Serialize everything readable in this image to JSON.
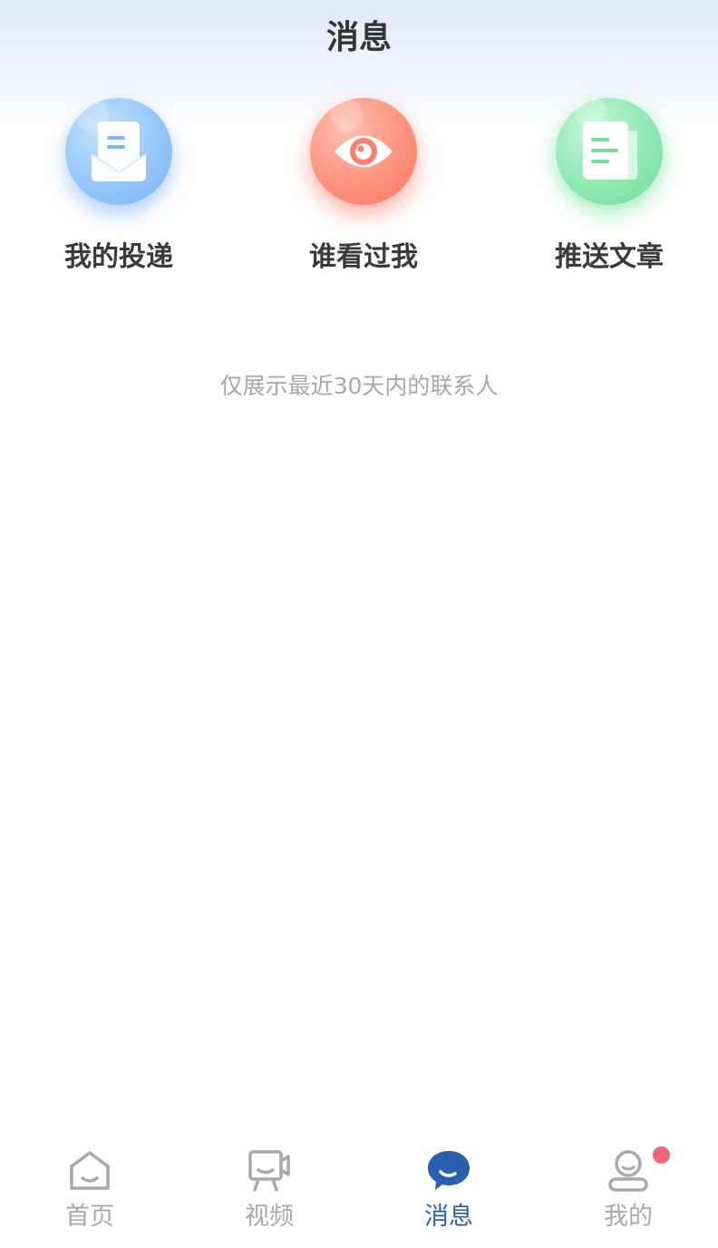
{
  "header": {
    "title": "消息"
  },
  "shortcuts": [
    {
      "label": "我的投递",
      "icon": "envelope-document-icon",
      "color": "#8fc2fa"
    },
    {
      "label": "谁看过我",
      "icon": "eye-icon",
      "color": "#fb8a74"
    },
    {
      "label": "推送文章",
      "icon": "article-icon",
      "color": "#86e6a8"
    }
  ],
  "main": {
    "notice": "仅展示最近30天内的联系人"
  },
  "tabbar": {
    "active_color": "#2a5fb0",
    "inactive_color": "#a9a9a9",
    "badge_color": "#f06477",
    "tabs": [
      {
        "label": "首页",
        "icon": "home-icon"
      },
      {
        "label": "视频",
        "icon": "video-icon"
      },
      {
        "label": "消息",
        "icon": "chat-bubble-icon",
        "active": true
      },
      {
        "label": "我的",
        "icon": "profile-icon",
        "badge": true
      }
    ]
  }
}
